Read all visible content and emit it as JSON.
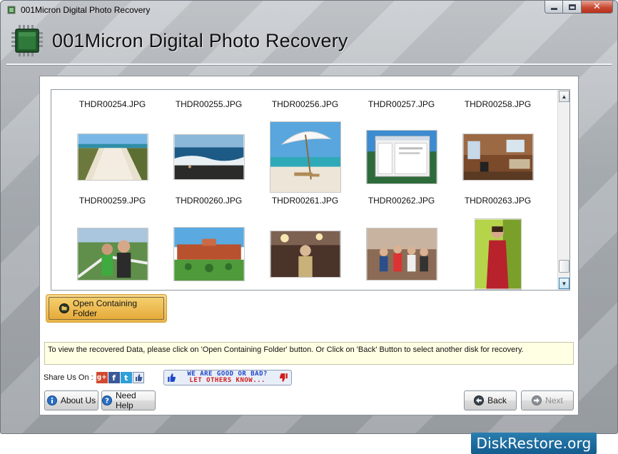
{
  "window": {
    "title": "001Micron Digital Photo Recovery",
    "controls": {
      "minimize": "minimize",
      "maximize": "maximize",
      "close": "✕"
    }
  },
  "header": {
    "title": "001Micron Digital Photo Recovery"
  },
  "gallery": {
    "rows": [
      {
        "names": [
          "THDR00254.JPG",
          "THDR00255.JPG",
          "THDR00256.JPG",
          "THDR00257.JPG",
          "THDR00258.JPG"
        ],
        "thumbs": [
          "beach-path",
          "ocean-waves",
          "beach-umbrella",
          "software-screenshot",
          "cabin-interior"
        ]
      },
      {
        "names": [
          "THDR00259.JPG",
          "THDR00260.JPG",
          "THDR00261.JPG",
          "THDR00262.JPG",
          "THDR00263.JPG"
        ],
        "thumbs": [
          "family-selfie",
          "red-fort",
          "party-person",
          "group-photo",
          "woman-red-dress"
        ]
      }
    ]
  },
  "buttons": {
    "open_folder": "Open Containing Folder",
    "about": "About Us",
    "help": "Need Help",
    "back": "Back",
    "next": "Next"
  },
  "info": {
    "message": "To view the recovered Data, please click on 'Open Containing Folder' button. Or Click on 'Back' Button to select another disk for recovery."
  },
  "share": {
    "label": "Share Us On :",
    "networks": [
      "g+",
      "f",
      "t"
    ],
    "feedback_line1": "WE ARE GOOD OR BAD?",
    "feedback_line2": "LET OTHERS KNOW..."
  },
  "brand": {
    "text": "DiskRestore.org"
  },
  "colors": {
    "accent_orange": "#e9b54c",
    "info_bg": "#ffffe4",
    "brand_blue": "#1b6a9c",
    "feedback_blue": "#1f46c8",
    "feedback_red": "#d11c1c"
  }
}
